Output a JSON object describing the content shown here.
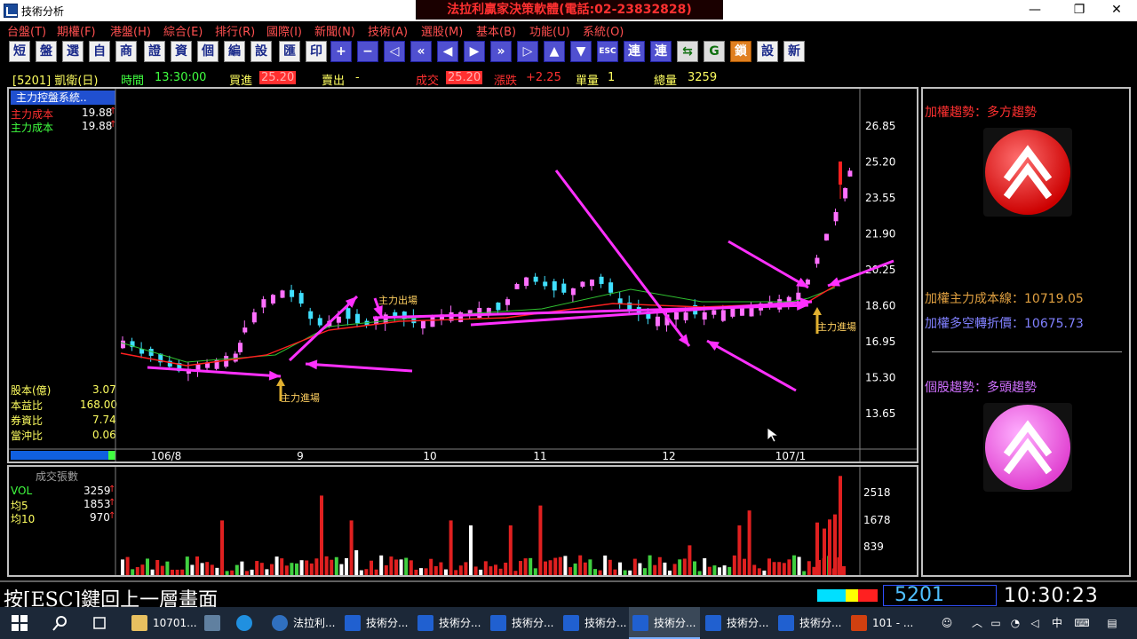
{
  "window": {
    "title": "技術分析",
    "ad_banner": "法拉利贏家決策軟體(電話:02-23832828)",
    "btn_min": "—",
    "btn_max": "❐",
    "btn_close": "✕"
  },
  "menu": [
    "台盤(T)",
    "期權(F)",
    "港盤(H)",
    "綜合(E)",
    "排行(R)",
    "國際(I)",
    "新聞(N)",
    "技術(A)",
    "選股(M)",
    "基本(B)",
    "功能(U)",
    "系統(O)"
  ],
  "toolbar": [
    {
      "label": "短",
      "icon": "short-icon",
      "style": "plain"
    },
    {
      "label": "盤",
      "icon": "board-icon",
      "style": "plain"
    },
    {
      "label": "選",
      "icon": "select-icon",
      "style": "plain"
    },
    {
      "label": "自",
      "icon": "self-icon",
      "style": "plain"
    },
    {
      "label": "商",
      "icon": "commerce-icon",
      "style": "plain"
    },
    {
      "label": "證",
      "icon": "securities-icon",
      "style": "plain"
    },
    {
      "label": "資",
      "icon": "funds-icon",
      "style": "plain"
    },
    {
      "label": "個",
      "icon": "individual-icon",
      "style": "plain"
    },
    {
      "label": "編",
      "icon": "edit-icon",
      "style": "plain"
    },
    {
      "label": "設",
      "icon": "settings-icon",
      "style": "plain"
    },
    {
      "label": "匯",
      "icon": "export-icon",
      "style": "plain"
    },
    {
      "label": "印",
      "icon": "print-icon",
      "style": "plain"
    },
    {
      "label": "+",
      "icon": "plus-icon",
      "style": "blue"
    },
    {
      "label": "−",
      "icon": "minus-icon",
      "style": "blue"
    },
    {
      "label": "◁",
      "icon": "left-end-icon",
      "style": "blue"
    },
    {
      "label": "«",
      "icon": "left-double-icon",
      "style": "blue"
    },
    {
      "label": "◀",
      "icon": "left-icon",
      "style": "blue"
    },
    {
      "label": "▶",
      "icon": "right-icon",
      "style": "blue"
    },
    {
      "label": "»",
      "icon": "right-double-icon",
      "style": "blue"
    },
    {
      "label": "▷",
      "icon": "right-end-icon",
      "style": "blue"
    },
    {
      "label": "▲",
      "icon": "up-icon",
      "style": "blue"
    },
    {
      "label": "▼",
      "icon": "down-icon",
      "style": "blue"
    },
    {
      "label": "ESC",
      "icon": "esc-icon",
      "style": "blue"
    },
    {
      "label": "連",
      "icon": "link-icon",
      "style": "blue"
    },
    {
      "label": "連",
      "icon": "link2-icon",
      "style": "blue"
    },
    {
      "label": "⇆",
      "icon": "switch-icon",
      "style": "green"
    },
    {
      "label": "G",
      "icon": "g-icon",
      "style": "green"
    },
    {
      "label": "鎖",
      "icon": "lock-icon",
      "style": "orange"
    },
    {
      "label": "設",
      "icon": "config-icon",
      "style": "plain"
    },
    {
      "label": "新",
      "icon": "new-icon",
      "style": "plain"
    }
  ],
  "quote": {
    "code_name": "[5201] 凱衛(日)",
    "time_label": "時間",
    "time": "13:30:00",
    "bid_label": "買進",
    "bid": "25.20",
    "ask_label": "賣出",
    "ask": "-",
    "trade_label": "成交",
    "trade": "25.20",
    "change_label": "漲跌",
    "change": "+2.25",
    "qty_label": "單量",
    "qty": "1",
    "total_label": "總量",
    "total": "3259"
  },
  "main_chart": {
    "system_title": "主力控盤系統..",
    "legend": [
      {
        "label": "主力成本",
        "value": "19.88",
        "arrow": "↑",
        "color": "#ff3030"
      },
      {
        "label": "主力成本",
        "value": "19.88",
        "arrow": "↑",
        "color": "#40ff40"
      }
    ],
    "y_ticks": [
      "26.85",
      "25.20",
      "23.55",
      "21.90",
      "20.25",
      "18.60",
      "16.95",
      "15.30",
      "13.65"
    ],
    "x_ticks": [
      "106/8",
      "9",
      "10",
      "11",
      "12",
      "107/1"
    ],
    "annotations": {
      "entry1": "主力進場",
      "exit": "主力出場",
      "entry2": "主力進場"
    },
    "fundamentals": [
      {
        "label": "股本(億)",
        "value": "3.07"
      },
      {
        "label": "本益比",
        "value": "168.00"
      },
      {
        "label": "券資比",
        "value": "7.74"
      },
      {
        "label": "當沖比",
        "value": "0.06"
      }
    ]
  },
  "volume_chart": {
    "title": "成交張數",
    "legend": [
      {
        "label": "VOL",
        "value": "3259",
        "arrow": "↑",
        "color": "#40ff40"
      },
      {
        "label": "均5",
        "value": "1853",
        "arrow": "↑",
        "color": "#ffff60"
      },
      {
        "label": "均10",
        "value": "970",
        "arrow": "↑",
        "color": "#ffff60"
      }
    ],
    "y_ticks": [
      "2518",
      "1678",
      "839"
    ]
  },
  "side_panel": {
    "weighted_trend": "加權趨勢：多方趨勢",
    "cost_line_label": "加權主力成本線：",
    "cost_line_value": "10719.05",
    "turn_price_label": "加權多空轉折價：",
    "turn_price_value": "10675.73",
    "stock_trend": "個股趨勢：多頭趨勢"
  },
  "status": {
    "esc_hint": "按[ESC]鍵回上一層畫面",
    "code": "5201",
    "clock": "10:30:23"
  },
  "taskbar": {
    "items": [
      {
        "label": "10701...",
        "icon": "folder-icon",
        "active": false
      },
      {
        "label": "",
        "icon": "network-icon",
        "active": false
      },
      {
        "label": "",
        "icon": "ie-icon",
        "active": false
      },
      {
        "label": "法拉利...",
        "icon": "ferrari-app-icon",
        "active": false
      },
      {
        "label": "技術分...",
        "icon": "chart-app-icon",
        "active": false
      },
      {
        "label": "技術分...",
        "icon": "chart-app-icon",
        "active": false
      },
      {
        "label": "技術分...",
        "icon": "chart-app-icon",
        "active": false
      },
      {
        "label": "技術分...",
        "icon": "chart-app-icon",
        "active": false
      },
      {
        "label": "技術分...",
        "icon": "chart-app-icon",
        "active": true
      },
      {
        "label": "技術分...",
        "icon": "chart-app-icon",
        "active": false
      },
      {
        "label": "技術分...",
        "icon": "chart-app-icon",
        "active": false
      },
      {
        "label": "101 - ...",
        "icon": "powerpoint-icon",
        "active": false
      }
    ],
    "ime": "中"
  },
  "chart_data": {
    "type": "candlestick",
    "x": [
      "106/8",
      "9",
      "10",
      "11",
      "12",
      "107/1"
    ],
    "ylim": [
      13.65,
      26.85
    ],
    "series": [
      {
        "name": "主力成本",
        "values": [
          17.3,
          16.4,
          18.2,
          18.6,
          18.9,
          19.88
        ]
      }
    ]
  }
}
